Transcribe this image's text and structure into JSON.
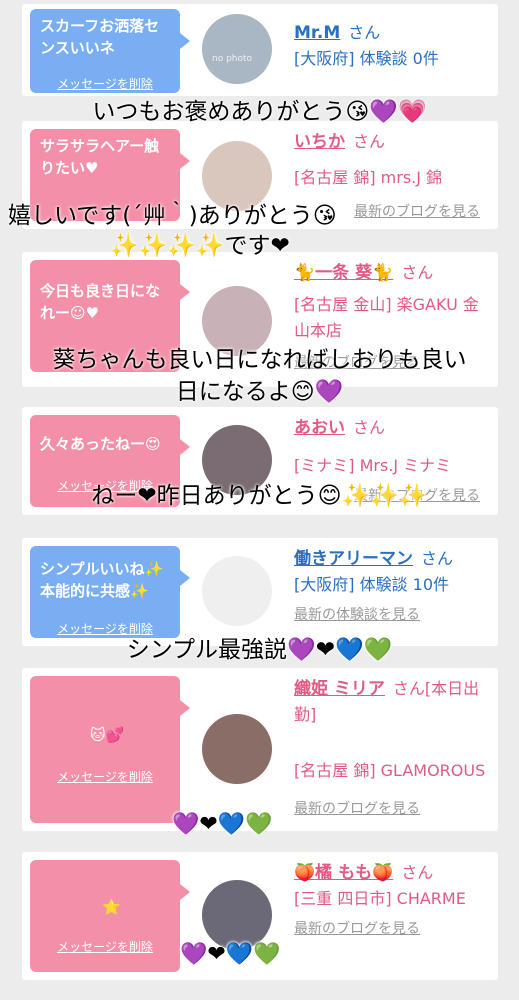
{
  "cards": [
    {
      "bubble": "スカーフお洒落センスいいネ",
      "delete": "メッセージを削除",
      "name": "Mr.M",
      "san": "さん",
      "line1": "[大阪府] 体験談 0件",
      "link": ""
    },
    {
      "bubble": "サラサラヘアー触りたい♥",
      "delete": "メッセージを削除",
      "name": "いちか",
      "san": "さん",
      "line1": "[名古屋 錦] mrs.J 錦",
      "link": "最新のブログを見る"
    },
    {
      "bubble": "今日も良き日になれー☺♥",
      "delete": "メッセージを削除",
      "name": "🐈一条 葵🐈",
      "san": "さん",
      "line1": "[名古屋 金山] 楽GAKU 金山本店",
      "link": "最新のブログを見る"
    },
    {
      "bubble": "久々あったねー😍",
      "delete": "メッセージを削除",
      "name": "あおい",
      "san": "さん",
      "line1": "[ミナミ] Mrs.J ミナミ",
      "link": "最新のブログを見る"
    },
    {
      "bubble": "シンプルいいね✨本能的に共感✨",
      "delete": "メッセージを削除",
      "name": "働きアリーマン",
      "san": "さん",
      "line1": "[大阪府] 体験談 10件",
      "link": "最新の体験談を見る"
    },
    {
      "bubble": "🐱💕",
      "delete": "メッセージを削除",
      "name": "織姫 ミリア",
      "san": "さん[本日出勤]",
      "line1": "[名古屋 錦] GLAMOROUS",
      "link": "最新のブログを見る"
    },
    {
      "bubble": "⭐",
      "delete": "メッセージを削除",
      "name": "🍑橘 もも🍑",
      "san": "さん",
      "line1": "[三重 四日市] CHARME",
      "link": "最新のブログを見る"
    }
  ],
  "avatar_text": "no photo",
  "overlays": [
    "いつもお褒めありがとう😘💜💗",
    "嬉しいです(´艸｀)ありがとう😘",
    "✨✨✨✨です❤",
    "葵ちゃんも良い日になればしおりも良い",
    "日になるよ😊💜",
    "ねー❤昨日ありがとう😊✨✨✨",
    "シンプル最強説💜❤💙💚",
    "💜❤💙💚",
    "💜❤💙💚"
  ]
}
